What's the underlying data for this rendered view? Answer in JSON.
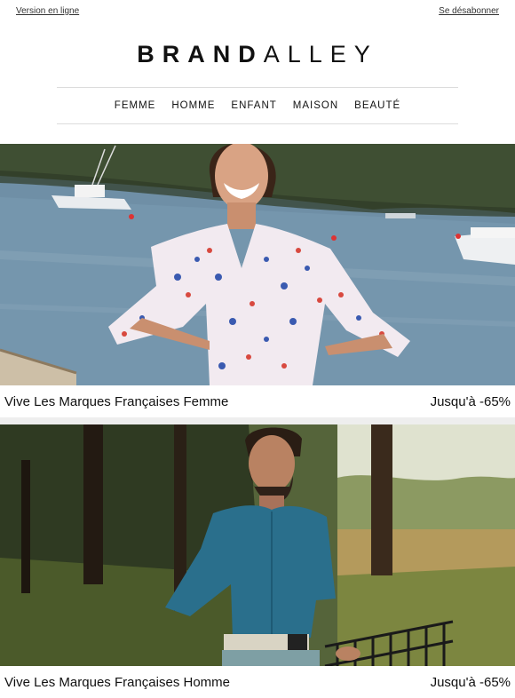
{
  "topbar": {
    "online_version": "Version en ligne",
    "unsubscribe": "Se désabonner"
  },
  "brand": {
    "bold_part": "BRAND",
    "light_part": "ALLEY"
  },
  "nav": {
    "items": [
      "FEMME",
      "HOMME",
      "ENFANT",
      "MAISON",
      "BEAUTÉ"
    ]
  },
  "promos": [
    {
      "title": "Vive Les Marques Françaises Femme",
      "discount": "Jusqu'à -65%",
      "image": "woman-floral-blouse-lake-photo"
    },
    {
      "title": "Vive Les Marques Françaises Homme",
      "discount": "Jusqu'à -65%",
      "image": "man-blue-shirt-forest-photo"
    }
  ],
  "colors": {
    "lake": "#6f8fa6",
    "forest": "#3d4a2a",
    "shirt": "#2a6f8c"
  }
}
